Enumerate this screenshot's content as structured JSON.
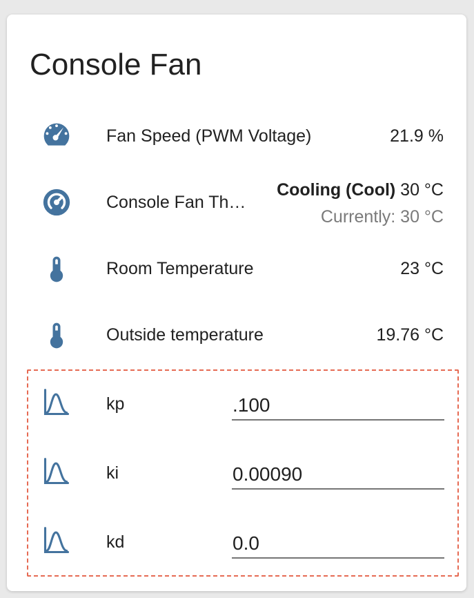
{
  "card": {
    "title": "Console Fan"
  },
  "colors": {
    "icon": "#44739e",
    "dashed_border": "#e66a53",
    "secondary_text": "#7a7a7a"
  },
  "entities": [
    {
      "icon": "gauge-icon",
      "name": "Fan Speed (PWM Voltage)",
      "value": "21.9 %"
    },
    {
      "icon": "thermostat-dial-icon",
      "name": "Console Fan Th…",
      "state_bold": "Cooling (Cool)",
      "state_target": " 30 °C",
      "state_current": "Currently: 30 °C"
    },
    {
      "icon": "thermometer-icon",
      "name": "Room Temperature",
      "value": "23 °C"
    },
    {
      "icon": "thermometer-icon",
      "name": "Outside temperature",
      "value": "19.76 °C"
    }
  ],
  "inputs": [
    {
      "icon": "bell-curve-icon",
      "name": "kp",
      "value": ".100"
    },
    {
      "icon": "bell-curve-icon",
      "name": "ki",
      "value": "0.00090"
    },
    {
      "icon": "bell-curve-icon",
      "name": "kd",
      "value": "0.0"
    }
  ]
}
